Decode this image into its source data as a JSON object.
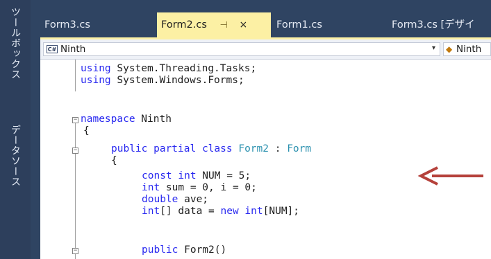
{
  "sidebar": {
    "tabs": [
      "ツールボックス",
      "データソース"
    ]
  },
  "tabs": [
    {
      "label": "Form3.cs",
      "active": false
    },
    {
      "label": "Form2.cs",
      "active": true,
      "pin": "⊣",
      "close": "×"
    },
    {
      "label": "Form1.cs",
      "active": false
    },
    {
      "label": "Form3.cs [デザイ",
      "active": false
    }
  ],
  "navbar": {
    "project_icon": "C#",
    "project": "Ninth",
    "type_member": "Ninth"
  },
  "code": {
    "using1": {
      "kw": "using",
      "rest": " System.Threading.Tasks;"
    },
    "using2": {
      "kw": "using",
      "rest": " System.Windows.Forms;"
    },
    "ns": {
      "kw": "namespace",
      "rest": " Ninth"
    },
    "brace_ns": "{",
    "cls": {
      "kw": "public partial class",
      "name": "Form2",
      "sep": " : ",
      "base": "Form"
    },
    "brace_cls": "{",
    "f1": {
      "kw": "const int",
      "rest": " NUM = 5;"
    },
    "f2": {
      "kw": "int",
      "rest": " sum = 0, i = 0;"
    },
    "f3": {
      "kw": "double",
      "rest": " ave;"
    },
    "f4": {
      "kw1": "int",
      "mid": "[] data = ",
      "kw2": "new int",
      "rest": "[NUM];"
    },
    "ctor": {
      "kw": "public",
      "rest": " Form2()"
    }
  },
  "annotation": {
    "color": "#b5413b"
  }
}
